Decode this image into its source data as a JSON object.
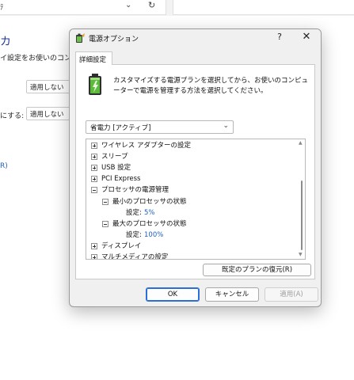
{
  "background": {
    "address_text": "ﾃ",
    "heading": "カ",
    "description": "イ設定をお使いのコンピ",
    "row2_label": "にする:",
    "select1_value": "適用しない",
    "select2_value": "適用しない",
    "link_text": "R)"
  },
  "dialog": {
    "title": "電源オプション",
    "help_label": "?",
    "close_label": "✕",
    "tab_label": "詳細設定",
    "description": "カスタマイズする電源プランを選択してから、お使いのコンピューターで電源を管理する方法を選択してください。",
    "plan_selected": "省電力 [アクティブ]",
    "tree": [
      {
        "label": "ワイヤレス アダプターの設定",
        "expander": "plus"
      },
      {
        "label": "スリープ",
        "expander": "plus"
      },
      {
        "label": "USB 設定",
        "expander": "plus"
      },
      {
        "label": "PCI Express",
        "expander": "plus"
      },
      {
        "label": "プロセッサの電源管理",
        "expander": "minus"
      },
      {
        "label": "最小のプロセッサの状態",
        "expander": "minus"
      },
      {
        "label": "設定:",
        "value": "5%"
      },
      {
        "label": "最大のプロセッサの状態",
        "expander": "minus"
      },
      {
        "label": "設定:",
        "value": "100%"
      },
      {
        "label": "ディスプレイ",
        "expander": "plus"
      },
      {
        "label": "マルチメディアの設定",
        "expander": "plus"
      }
    ],
    "restore_label": "既定のプランの復元(R)",
    "ok_label": "OK",
    "cancel_label": "キャンセル",
    "apply_label": "適用(A)"
  }
}
